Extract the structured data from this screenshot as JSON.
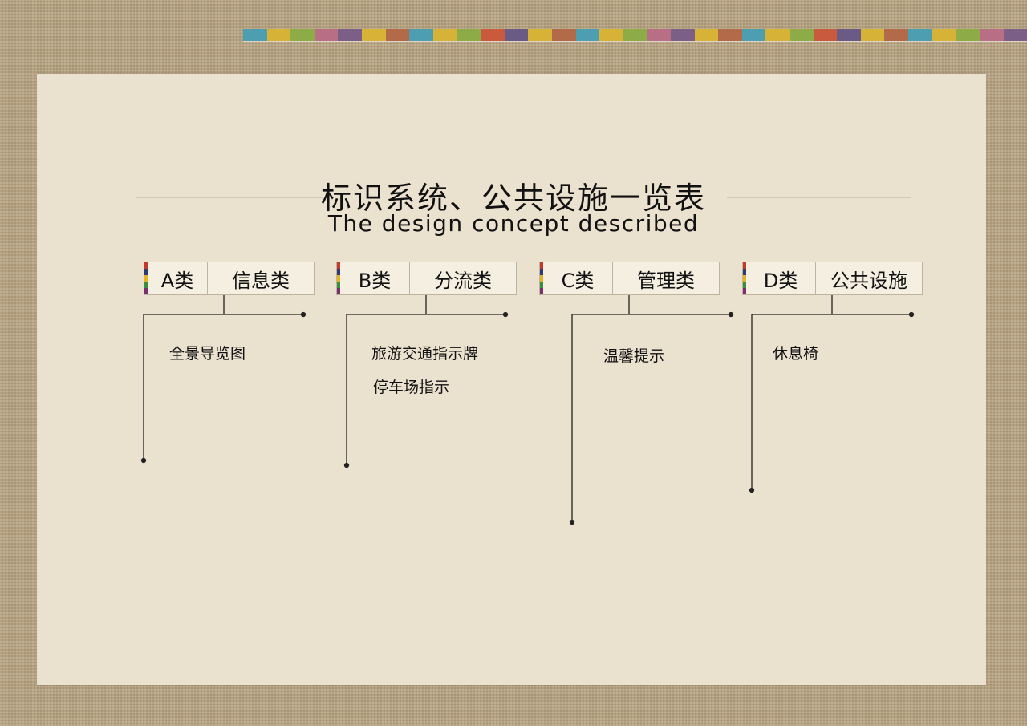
{
  "title": "标识系统、公共设施一览表",
  "subtitle": "The design concept described",
  "stripe_colors": [
    "#4d9eb0",
    "#d6b236",
    "#8dac48",
    "#b86f86",
    "#7b5f86",
    "#d6b236",
    "#b36a48",
    "#4d9eb0",
    "#d6b236",
    "#8dac48",
    "#c95a3e",
    "#6a5a86",
    "#d6b236",
    "#b36a48",
    "#4d9eb0",
    "#d6b236",
    "#8dac48",
    "#b86f86",
    "#7b5f86",
    "#d6b236",
    "#b36a48",
    "#4d9eb0",
    "#d6b236",
    "#8dac48",
    "#c95a3e",
    "#6a5a86",
    "#d6b236",
    "#b36a48",
    "#4d9eb0",
    "#d6b236",
    "#8dac48",
    "#b86f86",
    "#7b5f86"
  ],
  "categories": [
    {
      "code": "A类",
      "name": "信息类",
      "items": [
        "全景导览图"
      ]
    },
    {
      "code": "B类",
      "name": "分流类",
      "items": [
        "旅游交通指示牌",
        "停车场指示"
      ]
    },
    {
      "code": "C类",
      "name": "管理类",
      "items": [
        "温馨提示"
      ]
    },
    {
      "code": "D类",
      "name": "公共设施",
      "items": [
        "休息椅"
      ]
    }
  ]
}
